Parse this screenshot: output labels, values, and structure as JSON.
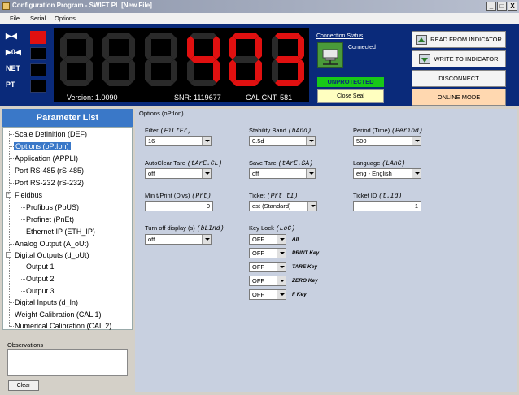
{
  "window": {
    "title": "Configuration Program - SWIFT PL  [New File]",
    "controls": [
      "_",
      "□",
      "X"
    ]
  },
  "menu": [
    "File",
    "Serial",
    "Options"
  ],
  "indicators": [
    {
      "label": "▶◀",
      "on": true
    },
    {
      "label": "▶0◀",
      "on": false
    },
    {
      "label": "NET",
      "on": false
    },
    {
      "label": "PT",
      "on": false
    }
  ],
  "display": {
    "value": "403",
    "version": "Version: 1.0090",
    "snr": "SNR: 1119677",
    "cal_cnt": "CAL CNT: 581",
    "lit_color": "#e01010",
    "unlit_color": "#2a2a2a"
  },
  "connection": {
    "title": "Connection Status",
    "state": "Connected",
    "protection": "UNPROTECTED",
    "close_seal": "Close Seal"
  },
  "actions": {
    "read": "READ FROM INDICATOR",
    "write": "WRITE TO INDICATOR",
    "disconnect": "DISCONNECT",
    "online": "ONLINE MODE"
  },
  "parameter_list": {
    "title": "Parameter List",
    "items": [
      "Scale Definition (DEF)",
      "Options (oPtIon)",
      "Application (APPLI)",
      "Port RS-485 (rS-485)",
      "Port RS-232 (rS-232)",
      "Fieldbus",
      "Profibus (PbUS)",
      "Profinet (PnEt)",
      "Ethernet IP (ETH_IP)",
      "Analog Output (A_oUt)",
      "Digital Outputs (d_oUt)",
      "Output 1",
      "Output 2",
      "Output 3",
      "Digital Inputs (d_In)",
      "Weight Calibration (CAL 1)",
      "Numerical Calibration (CAL 2)"
    ],
    "expand_symbol": "-"
  },
  "observations": {
    "label": "Observations",
    "clear": "Clear"
  },
  "options": {
    "section_title": "Options (oPtIon)",
    "filter": {
      "label": "Filter",
      "code": "(FiLtEr)",
      "value": "16"
    },
    "stability": {
      "label": "Stability Band",
      "code": "(bAnd)",
      "value": "0.5d"
    },
    "period": {
      "label": "Period (Time)",
      "code": "(Period)",
      "value": "500"
    },
    "autoclear": {
      "label": "AutoClear Tare",
      "code": "(tArE.CL)",
      "value": "off"
    },
    "savetare": {
      "label": "Save Tare",
      "code": "(tArE.SA)",
      "value": "off"
    },
    "language": {
      "label": "Language",
      "code": "(LAnG)",
      "value": "eng - English"
    },
    "minprint": {
      "label": "Min t/Print (Divs)",
      "code": "(Prt)",
      "value": "0"
    },
    "ticket": {
      "label": "Ticket",
      "code": "(Prt_tI)",
      "value": "est (Standard)"
    },
    "ticketid": {
      "label": "Ticket ID",
      "code": "(t.Id)",
      "value": "1"
    },
    "turnoff": {
      "label": "Turn off display (s)",
      "code": "(bLInd)",
      "value": "off"
    },
    "keylock": {
      "label": "Key Lock",
      "code": "(LoC)",
      "rows": [
        {
          "value": "OFF",
          "key": "All"
        },
        {
          "value": "OFF",
          "key": "PRINT Key"
        },
        {
          "value": "OFF",
          "key": "TARE Key"
        },
        {
          "value": "OFF",
          "key": "ZERO Key"
        },
        {
          "value": "OFF",
          "key": "F Key"
        }
      ]
    }
  }
}
